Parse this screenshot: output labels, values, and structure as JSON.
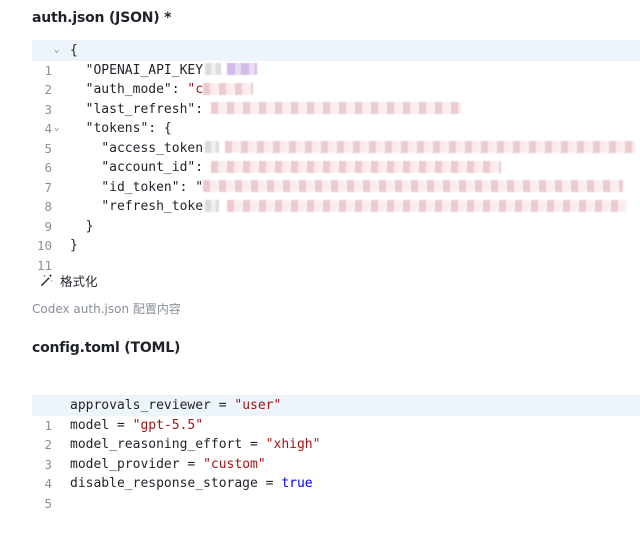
{
  "auth_section": {
    "title": "auth.json (JSON) *",
    "lines": [
      {
        "num": "1",
        "text": "{"
      },
      {
        "num": "2",
        "key": "\"OPENAI_API_KEY"
      },
      {
        "num": "3",
        "key": "\"auth_mode\"",
        "sep": ": ",
        "val": "\"c"
      },
      {
        "num": "4",
        "key": "\"last_refresh\"",
        "sep": ": "
      },
      {
        "num": "5",
        "key": "\"tokens\"",
        "sep": ": {"
      },
      {
        "num": "6",
        "key": "\"access_token"
      },
      {
        "num": "7",
        "key": "\"account_id\"",
        "sep": ": "
      },
      {
        "num": "8",
        "key": "\"id_token\"",
        "sep": ": \""
      },
      {
        "num": "9",
        "key": "\"refresh_toke"
      },
      {
        "num": "10",
        "text": "}"
      },
      {
        "num": "11",
        "text": "}"
      }
    ],
    "format_button_label": "格式化",
    "hint": "Codex auth.json 配置内容"
  },
  "config_section": {
    "title": "config.toml (TOML)",
    "lines": [
      {
        "num": "1",
        "key": "approvals_reviewer",
        "sep": " = ",
        "val": "\"user\""
      },
      {
        "num": "2",
        "key": "model",
        "sep": " = ",
        "val": "\"gpt-5.5\""
      },
      {
        "num": "3",
        "key": "model_reasoning_effort",
        "sep": " = ",
        "val": "\"xhigh\""
      },
      {
        "num": "4",
        "key": "model_provider",
        "sep": " = ",
        "val": "\"custom\""
      },
      {
        "num": "5",
        "key": "disable_response_storage",
        "sep": " = ",
        "val": "true"
      }
    ]
  },
  "colors": {
    "string": "#a31515",
    "keyword": "#0000ff",
    "active_line": "#eef4fb",
    "line_number": "#8a9099"
  },
  "icons": {
    "format": "magic-wand-icon",
    "fold": "chevron-down-icon"
  }
}
